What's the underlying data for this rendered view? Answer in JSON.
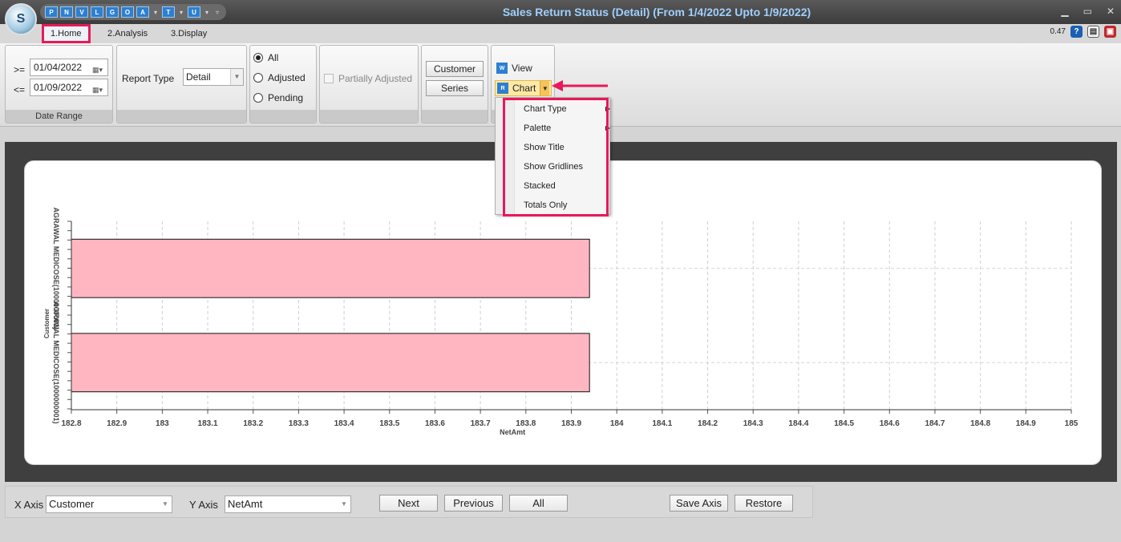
{
  "window": {
    "title": "Sales Return Status (Detail)  (From 1/4/2022 Upto 1/9/2022)",
    "qat_buttons": [
      "P",
      "N",
      "V",
      "L",
      "G",
      "O",
      "A",
      "T",
      "U"
    ],
    "version": "0.47"
  },
  "tabs": [
    {
      "label": "1.Home",
      "active": true
    },
    {
      "label": "2.Analysis",
      "active": false
    },
    {
      "label": "3.Display",
      "active": false
    }
  ],
  "date_range": {
    "from_op": ">=",
    "from_value": "01/04/2022",
    "to_op": "<=",
    "to_value": "01/09/2022",
    "group_label": "Date Range"
  },
  "report_type": {
    "label": "Report Type",
    "value": "Detail"
  },
  "status_filter": {
    "options": [
      "All",
      "Adjusted",
      "Pending"
    ],
    "selected": "All"
  },
  "partially_adjusted": {
    "label": "Partially Adjusted",
    "checked": false
  },
  "group_buttons": {
    "customer": "Customer",
    "series": "Series"
  },
  "view_chart": {
    "view": "View",
    "chart": "Chart"
  },
  "chart_menu": {
    "items": [
      {
        "label": "Chart Type",
        "submenu": true
      },
      {
        "label": "Palette",
        "submenu": true
      },
      {
        "label": "Show Title",
        "submenu": false
      },
      {
        "label": "Show Gridlines",
        "submenu": false
      },
      {
        "label": "Stacked",
        "submenu": false
      },
      {
        "label": "Totals Only",
        "submenu": false
      }
    ]
  },
  "chart_data": {
    "type": "bar",
    "orientation": "horizontal",
    "categories": [
      "AGRAWAL MEDICOSE(1000000001)",
      "AGRAWAL MEDICOSE(1000000001)"
    ],
    "values": [
      183.94,
      183.94
    ],
    "xlabel": "NetAmt",
    "ylabel": "Customer",
    "xlim": [
      182.8,
      185
    ],
    "xticks": [
      "182.8",
      "182.9",
      "183",
      "183.1",
      "183.2",
      "183.3",
      "183.4",
      "183.5",
      "183.6",
      "183.7",
      "183.8",
      "183.9",
      "184",
      "184.1",
      "184.2",
      "184.3",
      "184.4",
      "184.5",
      "184.6",
      "184.7",
      "184.8",
      "184.9",
      "185"
    ],
    "bar_color": "#ffb6c1",
    "grid": true
  },
  "axes_controls": {
    "x_label": "X Axis",
    "x_value": "Customer",
    "y_label": "Y Axis",
    "y_value": "NetAmt",
    "next": "Next",
    "previous": "Previous",
    "all": "All",
    "save_axis": "Save Axis",
    "restore": "Restore"
  },
  "colors": {
    "highlight": "#e8195a",
    "title_text": "#9fd0ff"
  }
}
